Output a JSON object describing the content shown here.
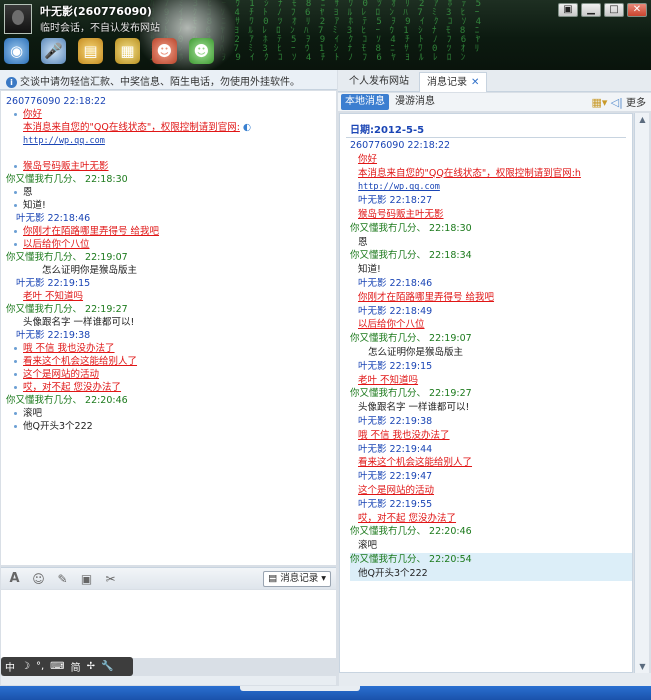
{
  "window": {
    "title": "叶无影(260776090)",
    "subtitle": "临时会话，不自认发布网站",
    "controls": [
      "▣",
      "▁",
      "□",
      "✕"
    ]
  },
  "toolbar": {
    "icons": [
      "camera-icon",
      "microphone-icon",
      "folder-transfer-icon",
      "app-icon",
      "remove-user-icon",
      "add-user-icon"
    ]
  },
  "notice": "交谈中请勿轻信汇款、中奖信息、陌生电话，勿使用外挂软件。",
  "conversation": [
    {
      "kind": "header",
      "color": "blue",
      "text": "260776090   22:18:22"
    },
    {
      "kind": "msg",
      "bullet": true,
      "style": "red",
      "text": "你好"
    },
    {
      "kind": "msg",
      "bullet": false,
      "style": "red",
      "text": "本消息来自您的\"QQ在线状态\"，权限控制请到官网:"
    },
    {
      "kind": "msg",
      "bullet": false,
      "style": "link",
      "text": "http://wp.qq.com"
    },
    {
      "kind": "blank"
    },
    {
      "kind": "msg",
      "bullet": true,
      "style": "red",
      "text": "猴岛号码贩主叶无影"
    },
    {
      "kind": "header",
      "color": "green",
      "text": "你又懂我冇几分、   22:18:30"
    },
    {
      "kind": "msg",
      "bullet": true,
      "style": "plain",
      "text": "恩"
    },
    {
      "kind": "msg",
      "bullet": true,
      "style": "plain",
      "text": "知道!"
    },
    {
      "kind": "header",
      "color": "blue",
      "indent": true,
      "text": "叶无影   22:18:46"
    },
    {
      "kind": "msg",
      "bullet": true,
      "style": "red",
      "text": "你刚才在陌路哪里弄得号 给我吧"
    },
    {
      "kind": "msg",
      "bullet": true,
      "style": "red",
      "text": "以后给你个八位"
    },
    {
      "kind": "header",
      "color": "green",
      "text": "你又懂我冇几分、   22:19:07"
    },
    {
      "kind": "msg",
      "bullet": false,
      "indent": true,
      "style": "plain",
      "text": "怎么证明你是猴岛版主"
    },
    {
      "kind": "header",
      "color": "blue",
      "indent": true,
      "text": "叶无影   22:19:15"
    },
    {
      "kind": "msg",
      "bullet": false,
      "style": "red",
      "text": "老叶  不知道吗"
    },
    {
      "kind": "header",
      "color": "green",
      "text": "你又懂我冇几分、   22:19:27"
    },
    {
      "kind": "msg",
      "bullet": false,
      "style": "plain",
      "text": "头像跟名字 一样谁都可以!"
    },
    {
      "kind": "header",
      "color": "blue",
      "indent": true,
      "text": "叶无影   22:19:38"
    },
    {
      "kind": "msg",
      "bullet": true,
      "style": "red",
      "text": "哦 不信 我也没办法了"
    },
    {
      "kind": "msg",
      "bullet": true,
      "style": "red",
      "text": "看来这个机会这能给别人了"
    },
    {
      "kind": "msg",
      "bullet": true,
      "style": "red",
      "text": "这个是网站的活动"
    },
    {
      "kind": "msg",
      "bullet": true,
      "style": "red",
      "text": "哎，对不起 您没办法了"
    },
    {
      "kind": "header",
      "color": "green",
      "text": "你又懂我冇几分、   22:20:46"
    },
    {
      "kind": "msg",
      "bullet": true,
      "style": "plain",
      "text": "滚吧"
    },
    {
      "kind": "msg",
      "bullet": true,
      "style": "plain",
      "text": "他Q开头3个222"
    }
  ],
  "chat_tools": {
    "icons": [
      "font-icon",
      "emoji-icon",
      "edit-icon",
      "image-icon",
      "screenshot-icon"
    ],
    "message_log_button": "消息记录"
  },
  "ime_bar": [
    "中",
    "☽",
    "°,",
    "⌨",
    "简",
    "✢",
    "🔧"
  ],
  "tabs": [
    {
      "label": "个人发布网站",
      "active": false
    },
    {
      "label": "消息记录",
      "active": true
    }
  ],
  "subtabs": [
    {
      "label": "本地消息",
      "active": true
    },
    {
      "label": "漫游消息",
      "active": false
    }
  ],
  "more_label": "更多",
  "history": {
    "date": "日期:2012-5-5",
    "lines": [
      {
        "t": "260776090   22:18:22",
        "s": "blue",
        "i": 0
      },
      {
        "t": "你好",
        "s": "red",
        "i": 1
      },
      {
        "t": "本消息来自您的\"QQ在线状态\"，权限控制请到官网:h",
        "s": "red",
        "i": 1
      },
      {
        "t": "http://wp.qq.com",
        "s": "link",
        "i": 1
      },
      {
        "t": "叶无影   22:18:27",
        "s": "blue",
        "i": 1
      },
      {
        "t": "猴岛号码贩主叶无影",
        "s": "red",
        "i": 1
      },
      {
        "t": "你又懂我冇几分、   22:18:30",
        "s": "green",
        "i": 0
      },
      {
        "t": "恩",
        "s": "plain",
        "i": 1
      },
      {
        "t": "你又懂我冇几分、   22:18:34",
        "s": "green",
        "i": 0
      },
      {
        "t": "知道!",
        "s": "plain",
        "i": 1
      },
      {
        "t": "叶无影   22:18:46",
        "s": "blue",
        "i": 1
      },
      {
        "t": "你刚才在陌路哪里弄得号 给我吧",
        "s": "red",
        "i": 1
      },
      {
        "t": "叶无影   22:18:49",
        "s": "blue",
        "i": 1
      },
      {
        "t": "以后给你个八位",
        "s": "red",
        "i": 1
      },
      {
        "t": "你又懂我冇几分、   22:19:07",
        "s": "green",
        "i": 0
      },
      {
        "t": "怎么证明你是猴岛版主",
        "s": "plain",
        "i": 2
      },
      {
        "t": "叶无影   22:19:15",
        "s": "blue",
        "i": 1
      },
      {
        "t": "老叶  不知道吗",
        "s": "red",
        "i": 1
      },
      {
        "t": "你又懂我冇几分、   22:19:27",
        "s": "green",
        "i": 0
      },
      {
        "t": "头像跟名字 一样谁都可以!",
        "s": "plain",
        "i": 1
      },
      {
        "t": "叶无影   22:19:38",
        "s": "blue",
        "i": 1
      },
      {
        "t": "哦 不信 我也没办法了",
        "s": "red",
        "i": 1
      },
      {
        "t": "叶无影   22:19:44",
        "s": "blue",
        "i": 1
      },
      {
        "t": "看来这个机会这能给别人了",
        "s": "red",
        "i": 1
      },
      {
        "t": "叶无影   22:19:47",
        "s": "blue",
        "i": 1
      },
      {
        "t": "这个是网站的活动",
        "s": "red",
        "i": 1
      },
      {
        "t": "叶无影   22:19:55",
        "s": "blue",
        "i": 1
      },
      {
        "t": "哎，对不起 您没办法了",
        "s": "red",
        "i": 1
      },
      {
        "t": "你又懂我冇几分、   22:20:46",
        "s": "green",
        "i": 0
      },
      {
        "t": "滚吧",
        "s": "plain",
        "i": 1
      },
      {
        "t": "你又懂我冇几分、   22:20:54",
        "s": "green",
        "i": 0,
        "hl": true
      },
      {
        "t": "他Q开头3个222",
        "s": "plain",
        "i": 1,
        "hl": true
      }
    ]
  }
}
